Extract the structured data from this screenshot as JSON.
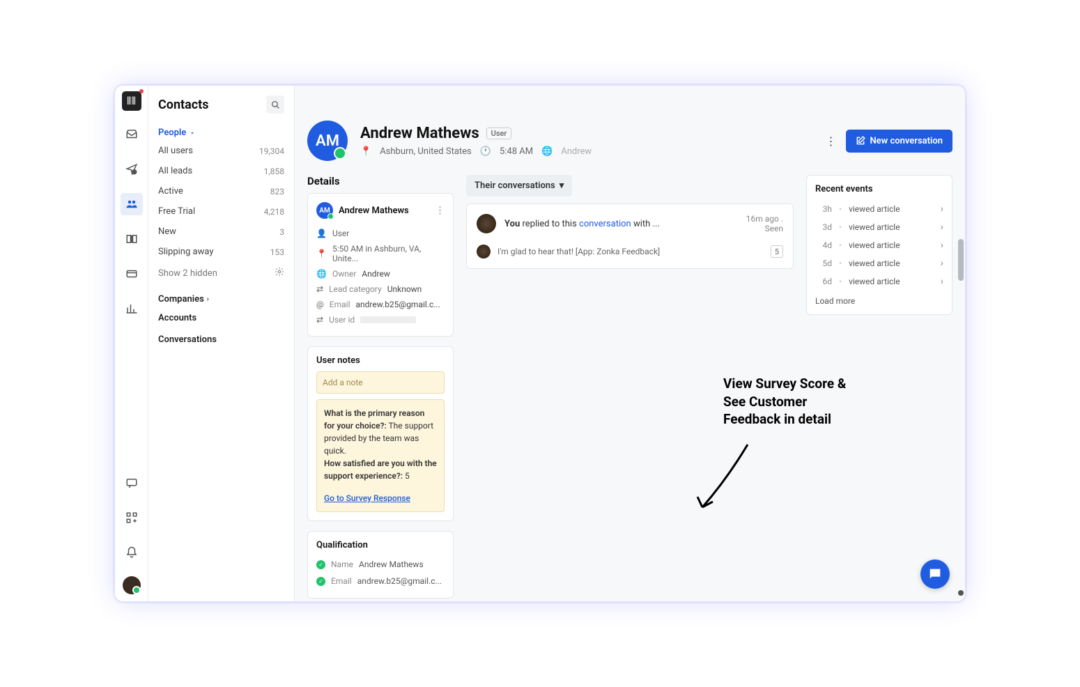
{
  "sidebar": {
    "title": "Contacts",
    "dropdown": "People",
    "items": [
      {
        "label": "All users",
        "count": "19,304"
      },
      {
        "label": "All leads",
        "count": "1,858"
      },
      {
        "label": "Active",
        "count": "823"
      },
      {
        "label": "Free Trial",
        "count": "4,218"
      },
      {
        "label": "New",
        "count": "3"
      },
      {
        "label": "Slipping away",
        "count": "153"
      }
    ],
    "show_hidden": "Show 2 hidden",
    "sections": {
      "companies": "Companies",
      "accounts": "Accounts",
      "conversations": "Conversations"
    }
  },
  "profile": {
    "initials": "AM",
    "name": "Andrew Mathews",
    "badge": "User",
    "location": "Ashburn, United States",
    "time": "5:48 AM",
    "owner": "Andrew",
    "button": "New conversation"
  },
  "details": {
    "title": "Details",
    "card_name": "Andrew Mathews",
    "role": "User",
    "time_loc": "5:50 AM in Ashburn, VA, Unite...",
    "owner_label": "Owner",
    "owner_val": "Andrew",
    "lead_label": "Lead category",
    "lead_val": "Unknown",
    "email_label": "Email",
    "email_val": "andrew.b25@gmail.c...",
    "userid_label": "User id"
  },
  "notes": {
    "title": "User notes",
    "placeholder": "Add a note",
    "q1": "What is the primary reason for your choice?:",
    "a1": " The support provided by the team was quick.",
    "q2": "How satisfied are you with the support experience?:",
    "a2": " 5",
    "link": "Go to Survey Response"
  },
  "qualification": {
    "title": "Qualification",
    "name_label": "Name",
    "name_val": "Andrew Mathews",
    "email_label": "Email",
    "email_val": "andrew.b25@gmail.c..."
  },
  "conversations": {
    "tab": "Their conversations",
    "you": "You",
    "replied": " replied to this ",
    "conv": "conversation",
    "with": " with ...",
    "time": "16m ago .",
    "seen": "Seen",
    "reply": "I'm glad to hear that! [App: Zonka Feedback]",
    "score": "5"
  },
  "recent": {
    "title": "Recent events",
    "items": [
      {
        "time": "3h",
        "text": "viewed article"
      },
      {
        "time": "3d",
        "text": "viewed article"
      },
      {
        "time": "4d",
        "text": "viewed article"
      },
      {
        "time": "5d",
        "text": "viewed article"
      },
      {
        "time": "6d",
        "text": "viewed article"
      }
    ],
    "load_more": "Load more"
  },
  "annotation": {
    "line1": "View Survey Score &",
    "line2": "See Customer",
    "line3": "Feedback in detail"
  }
}
